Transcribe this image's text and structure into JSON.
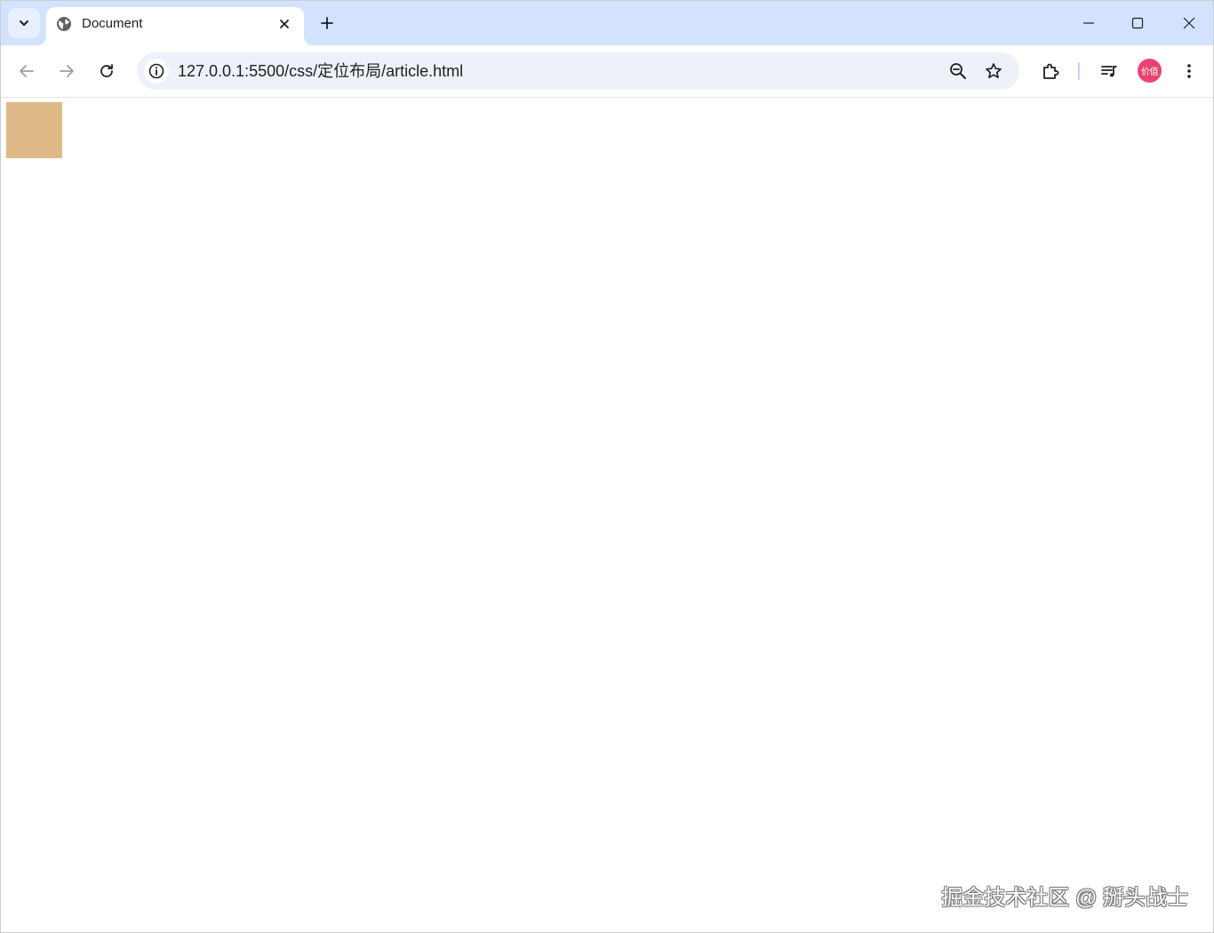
{
  "browser": {
    "tab": {
      "title": "Document"
    },
    "address_bar": {
      "url": "127.0.0.1:5500/css/定位布局/article.html"
    },
    "profile": {
      "label": "价值",
      "color": "#e8436f"
    }
  },
  "page": {
    "box_color": "#deb887"
  },
  "watermark": {
    "text": "掘金技术社区 @ 掰头战士"
  },
  "icons": {
    "tab_search": "chevron-down-icon",
    "favicon": "globe-icon",
    "tab_close": "close-icon",
    "new_tab": "plus-icon",
    "minimize": "minimize-icon",
    "maximize": "maximize-icon",
    "window_close": "close-icon",
    "back": "arrow-left-icon",
    "forward": "arrow-right-icon",
    "reload": "reload-icon",
    "site_info": "info-icon",
    "zoom": "zoom-out-icon",
    "bookmark": "star-icon",
    "extensions": "puzzle-icon",
    "media": "media-control-icon",
    "menu": "kebab-menu-icon"
  }
}
